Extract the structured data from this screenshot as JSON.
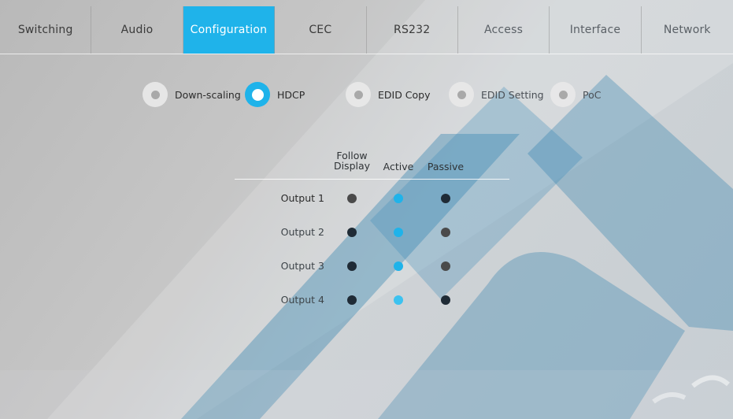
{
  "tabs": [
    {
      "label": "Switching",
      "active": false
    },
    {
      "label": "Audio",
      "active": false
    },
    {
      "label": "Configuration",
      "active": true
    },
    {
      "label": "CEC",
      "active": false
    },
    {
      "label": "RS232",
      "active": false
    },
    {
      "label": "Access",
      "active": false
    },
    {
      "label": "Interface",
      "active": false
    },
    {
      "label": "Network",
      "active": false
    }
  ],
  "subtabs": [
    {
      "label": "Down-scaling",
      "selected": false
    },
    {
      "label": "HDCP",
      "selected": true
    },
    {
      "label": "EDID Copy",
      "selected": false
    },
    {
      "label": "EDID Setting",
      "selected": false
    },
    {
      "label": "PoC",
      "selected": false
    }
  ],
  "hdcp": {
    "columns": [
      "Follow\nDisplay",
      "Active",
      "Passive"
    ],
    "rows": [
      {
        "label": "Output 1",
        "states": [
          "off",
          "selected",
          "dark"
        ]
      },
      {
        "label": "Output 2",
        "states": [
          "dark",
          "selected",
          "off"
        ]
      },
      {
        "label": "Output 3",
        "states": [
          "dark",
          "selected",
          "off"
        ]
      },
      {
        "label": "Output 4",
        "states": [
          "dark",
          "selected",
          "dark"
        ]
      }
    ]
  },
  "colors": {
    "accent": "#1fb3ea",
    "dot_dark": "#1f2b36",
    "dot_off": "#4a4a4a",
    "dot_selected": "#1fb3ea"
  },
  "icons": {
    "radio": "radio-button-icon",
    "watermark": "brand-watermark-icon"
  }
}
